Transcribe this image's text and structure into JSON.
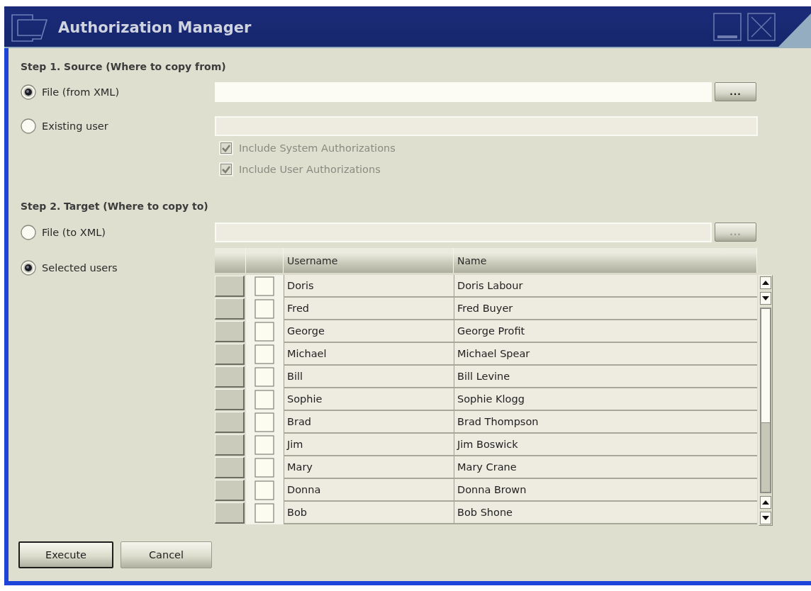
{
  "window": {
    "title": "Authorization Manager"
  },
  "source": {
    "heading": "Step 1. Source (Where to copy from)",
    "options": [
      {
        "label": "File (from XML)",
        "selected": true
      },
      {
        "label": "Existing user",
        "selected": false
      }
    ],
    "browse_button": "...",
    "checkboxes": [
      {
        "label": "Include System Authorizations",
        "checked": true
      },
      {
        "label": "Include User Authorizations",
        "checked": true
      }
    ]
  },
  "target": {
    "heading": "Step 2. Target (Where to copy to)",
    "options": [
      {
        "label": "File (to XML)",
        "selected": false
      },
      {
        "label": "Selected users",
        "selected": true
      }
    ],
    "browse_button": "...",
    "table": {
      "columns": [
        "Username",
        "Name"
      ],
      "rows": [
        {
          "username": "Doris",
          "name": "Doris Labour",
          "checked": false
        },
        {
          "username": "Fred",
          "name": "Fred Buyer",
          "checked": false
        },
        {
          "username": "George",
          "name": "George Profit",
          "checked": false
        },
        {
          "username": "Michael",
          "name": "Michael Spear",
          "checked": false
        },
        {
          "username": "Bill",
          "name": "Bill Levine",
          "checked": false
        },
        {
          "username": "Sophie",
          "name": "Sophie Klogg",
          "checked": false
        },
        {
          "username": "Brad",
          "name": "Brad Thompson",
          "checked": false
        },
        {
          "username": "Jim",
          "name": "Jim Boswick",
          "checked": false
        },
        {
          "username": "Mary",
          "name": "Mary Crane",
          "checked": false
        },
        {
          "username": "Donna",
          "name": "Donna Brown",
          "checked": false
        },
        {
          "username": "Bob",
          "name": "Bob Shone",
          "checked": false
        }
      ]
    }
  },
  "buttons": [
    {
      "label": "Execute",
      "default": true
    },
    {
      "label": "Cancel",
      "default": false
    }
  ]
}
